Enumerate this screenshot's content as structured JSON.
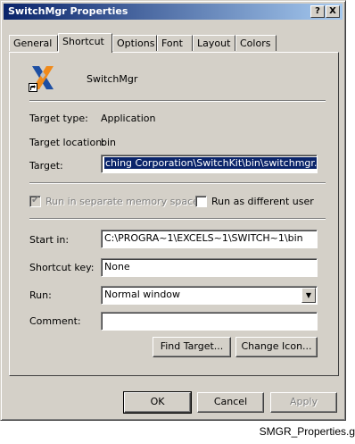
{
  "window": {
    "title": "SwitchMgr Properties",
    "help_btn": "?",
    "close_btn": "X"
  },
  "tabs": [
    {
      "label": "General"
    },
    {
      "label": "Shortcut"
    },
    {
      "label": "Options"
    },
    {
      "label": "Font"
    },
    {
      "label": "Layout"
    },
    {
      "label": "Colors"
    }
  ],
  "shortcut": {
    "name": "SwitchMgr",
    "target_type_label": "Target type:",
    "target_type_value": "Application",
    "target_location_label": "Target location:",
    "target_location_value": "bin",
    "target_label": "Target:",
    "target_value": "ching Corporation\\SwitchKit\\bin\\switchmgr.exe\"",
    "separate_memory_label": "Run in separate memory space",
    "different_user_label": "Run as different user",
    "start_in_label": "Start in:",
    "start_in_value": "C:\\PROGRA~1\\EXCELS~1\\SWITCH~1\\bin",
    "shortcut_key_label": "Shortcut key:",
    "shortcut_key_value": "None",
    "run_label": "Run:",
    "run_value": "Normal window",
    "comment_label": "Comment:",
    "comment_value": "",
    "find_target_label": "Find Target...",
    "change_icon_label": "Change Icon..."
  },
  "footer": {
    "ok_label": "OK",
    "cancel_label": "Cancel",
    "apply_label": "Apply"
  },
  "caption": "SMGR_Properties.g",
  "icons": [
    "switchmgr-app-icon",
    "shortcut-arrow-icon",
    "dropdown-arrow-icon",
    "help-icon",
    "close-icon",
    "checkmark-icon"
  ]
}
